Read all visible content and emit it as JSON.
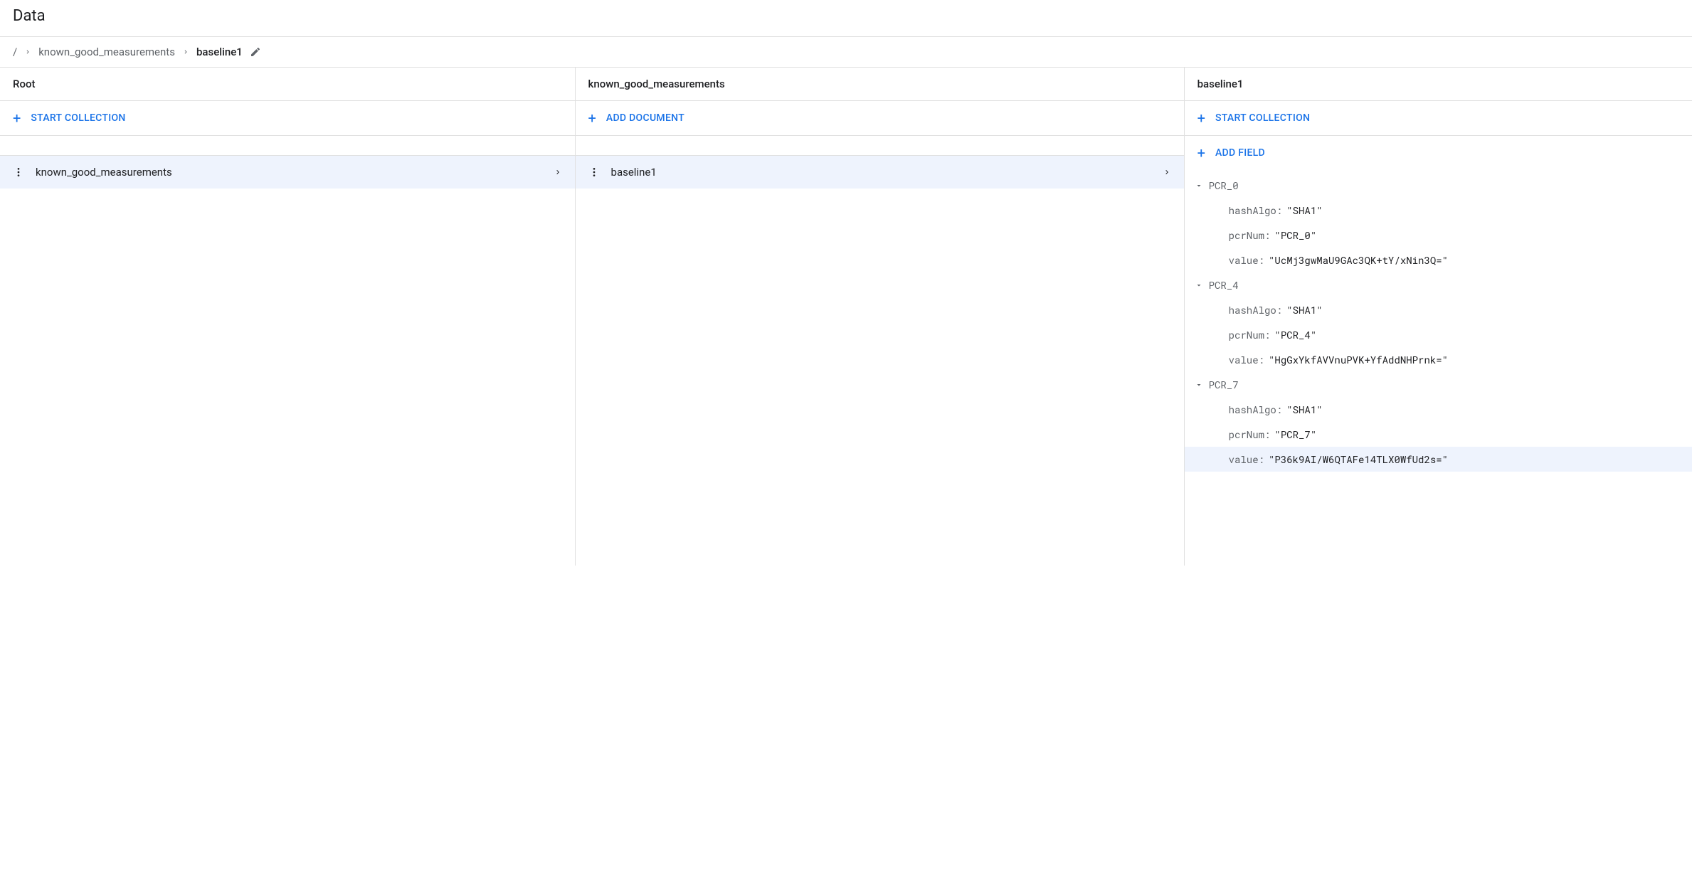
{
  "title": "Data",
  "breadcrumb": {
    "root": "/",
    "collection": "known_good_measurements",
    "document": "baseline1"
  },
  "panels": [
    {
      "header": "Root",
      "action": "START COLLECTION",
      "items": [
        "known_good_measurements"
      ]
    },
    {
      "header": "known_good_measurements",
      "action": "ADD DOCUMENT",
      "items": [
        "baseline1"
      ]
    },
    {
      "header": "baseline1",
      "action": "START COLLECTION",
      "secondary_action": "ADD FIELD",
      "fields": [
        {
          "key": "PCR_0",
          "children": {
            "hashAlgo": "SHA1",
            "pcrNum": "PCR_0",
            "value": "UcMj3gwMaU9GAc3QK+tY/xNin3Q="
          }
        },
        {
          "key": "PCR_4",
          "children": {
            "hashAlgo": "SHA1",
            "pcrNum": "PCR_4",
            "value": "HgGxYkfAVVnuPVK+YfAddNHPrnk="
          }
        },
        {
          "key": "PCR_7",
          "children": {
            "hashAlgo": "SHA1",
            "pcrNum": "PCR_7",
            "value": "P36k9AI/W6QTAFe14TLX0WfUd2s="
          }
        }
      ]
    }
  ]
}
